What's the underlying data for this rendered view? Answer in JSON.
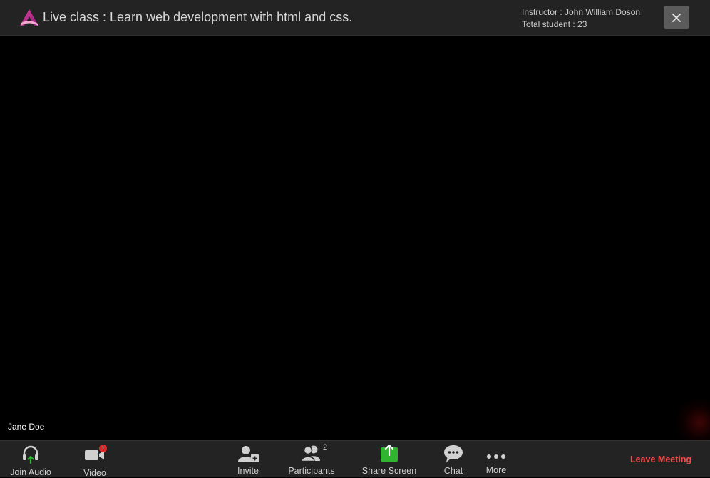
{
  "header": {
    "title": "Live class : Learn web development with html and css.",
    "instructor": "Instructor : John William Doson",
    "total_students": "Total student : 23",
    "close_icon": "close-icon"
  },
  "video": {
    "participant_name": "Jane Doe"
  },
  "toolbar": {
    "join_audio": "Join Audio",
    "video": "Video",
    "video_badge": "!",
    "invite": "Invite",
    "participants": "Participants",
    "participants_count": "2",
    "share_screen": "Share Screen",
    "chat": "Chat",
    "more": "More",
    "leave_meeting": "Leave Meeting"
  },
  "colors": {
    "share_green": "#2fb52f",
    "leave_red": "#f04c4c",
    "header_bg": "#232323",
    "accent_magenta": "#c2187a"
  }
}
